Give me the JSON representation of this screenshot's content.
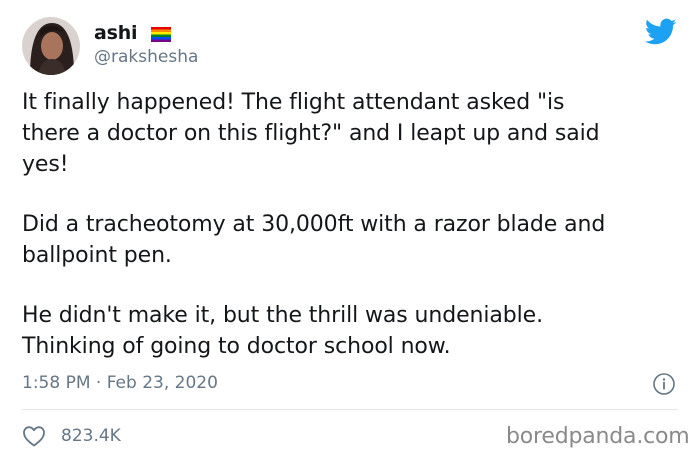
{
  "author": {
    "display_name": "ashi",
    "handle": "@rakshesha",
    "flag_icon": "rainbow-flag-icon"
  },
  "tweet": {
    "paragraphs": [
      {
        "lines": [
          "It finally happened! The flight attendant asked \"is",
          "there a doctor on this flight?\" and I leapt up and said",
          "yes!"
        ]
      },
      {
        "lines": [
          "Did a tracheotomy at 30,000ft with a razor blade and",
          "ballpoint pen."
        ]
      },
      {
        "lines": [
          "He didn't make it, but the thrill was undeniable.",
          "Thinking of going to doctor school now."
        ]
      }
    ],
    "timestamp": "1:58 PM · Feb 23, 2020",
    "likes": "823.4K"
  },
  "watermark": "boredpanda.com",
  "colors": {
    "twitter_blue": "#1da1f2",
    "text": "#14171a",
    "muted": "#657786"
  }
}
